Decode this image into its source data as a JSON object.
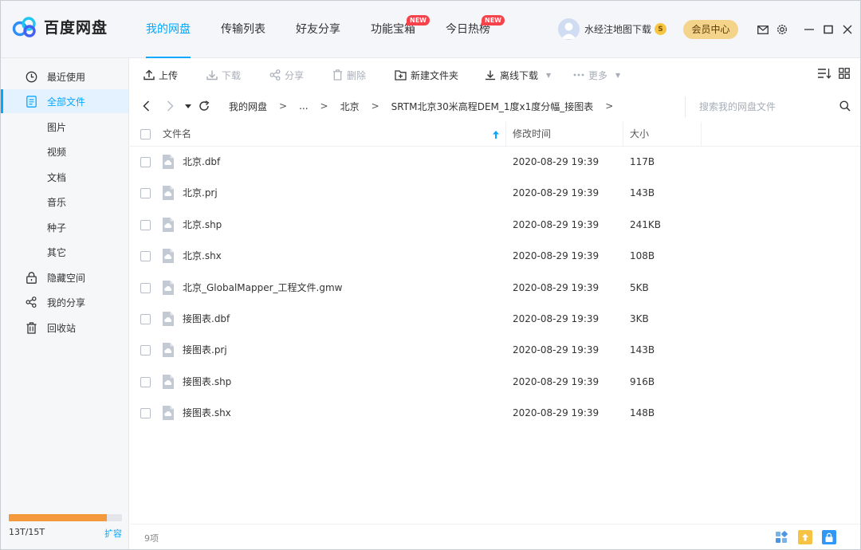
{
  "app": {
    "name": "百度网盘"
  },
  "nav": {
    "items": [
      {
        "label": "我的网盘",
        "badge": ""
      },
      {
        "label": "传输列表",
        "badge": ""
      },
      {
        "label": "好友分享",
        "badge": ""
      },
      {
        "label": "功能宝箱",
        "badge": "NEW"
      },
      {
        "label": "今日热榜",
        "badge": "NEW"
      }
    ]
  },
  "user": {
    "name": "水经注地图下载",
    "coin": "S",
    "member_button": "会员中心"
  },
  "sidebar": {
    "items": [
      {
        "label": "最近使用",
        "icon": "clock-icon"
      },
      {
        "label": "全部文件",
        "icon": "document-icon",
        "active": true
      },
      {
        "label": "图片"
      },
      {
        "label": "视频"
      },
      {
        "label": "文档"
      },
      {
        "label": "音乐"
      },
      {
        "label": "种子"
      },
      {
        "label": "其它"
      },
      {
        "label": "隐藏空间",
        "icon": "lock-icon"
      },
      {
        "label": "我的分享",
        "icon": "share-icon"
      },
      {
        "label": "回收站",
        "icon": "trash-icon"
      }
    ],
    "storage": {
      "text": "13T/15T",
      "used_fraction": 0.867,
      "expand_label": "扩容"
    }
  },
  "toolbar": {
    "upload": "上传",
    "download": "下载",
    "share": "分享",
    "delete": "删除",
    "new_folder": "新建文件夹",
    "offline_download": "离线下载",
    "more": "更多"
  },
  "path": {
    "crumbs": [
      "我的网盘",
      "...",
      "北京",
      "SRTM北京30米高程DEM_1度x1度分幅_接图表"
    ],
    "search_placeholder": "搜索我的网盘文件"
  },
  "table": {
    "headers": {
      "name": "文件名",
      "modified": "修改时间",
      "size": "大小"
    },
    "rows": [
      {
        "name": "北京.dbf",
        "modified": "2020-08-29 19:39",
        "size": "117B"
      },
      {
        "name": "北京.prj",
        "modified": "2020-08-29 19:39",
        "size": "143B"
      },
      {
        "name": "北京.shp",
        "modified": "2020-08-29 19:39",
        "size": "241KB"
      },
      {
        "name": "北京.shx",
        "modified": "2020-08-29 19:39",
        "size": "108B"
      },
      {
        "name": "北京_GlobalMapper_工程文件.gmw",
        "modified": "2020-08-29 19:39",
        "size": "5KB"
      },
      {
        "name": "接图表.dbf",
        "modified": "2020-08-29 19:39",
        "size": "3KB"
      },
      {
        "name": "接图表.prj",
        "modified": "2020-08-29 19:39",
        "size": "143B"
      },
      {
        "name": "接图表.shp",
        "modified": "2020-08-29 19:39",
        "size": "916B"
      },
      {
        "name": "接图表.shx",
        "modified": "2020-08-29 19:39",
        "size": "148B"
      }
    ]
  },
  "status": {
    "count": "9项"
  },
  "colors": {
    "accent": "#06a7ff",
    "storage_fill": "#f49a3d",
    "new_badge": "#f6424a",
    "member": "#f4d48b"
  }
}
